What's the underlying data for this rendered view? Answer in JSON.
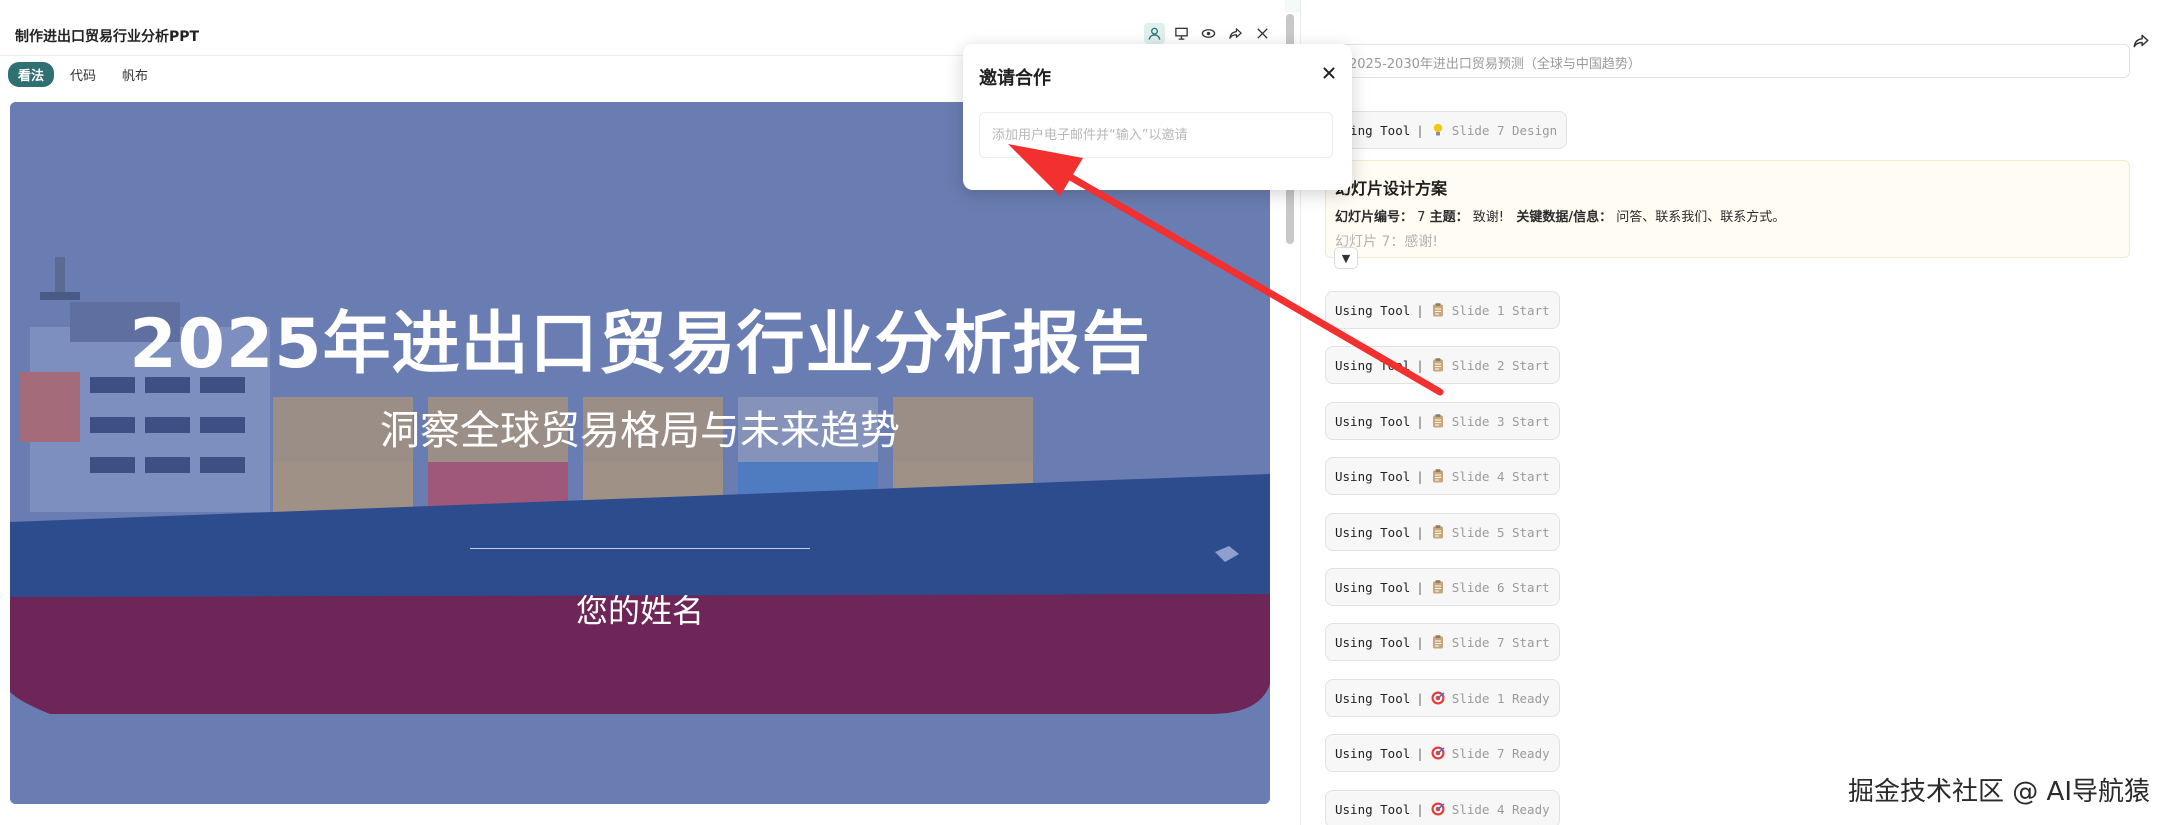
{
  "document": {
    "title": "制作进出口贸易行业分析PPT"
  },
  "header_icons": [
    {
      "name": "collaborator-icon"
    },
    {
      "name": "present-icon"
    },
    {
      "name": "preview-icon"
    },
    {
      "name": "share-icon"
    },
    {
      "name": "close-icon"
    }
  ],
  "tabs": [
    {
      "label": "看法",
      "active": true
    },
    {
      "label": "代码",
      "active": false
    },
    {
      "label": "帆布",
      "active": false
    }
  ],
  "slide": {
    "title": "2025年进出口贸易行业分析报告",
    "subtitle": "洞察全球贸易格局与未来趋势",
    "author": "您的姓名"
  },
  "invite": {
    "title": "邀请合作",
    "placeholder": "添加用户电子邮件并“输入”以邀请"
  },
  "right": {
    "prompt_text": "2025-2030年进出口贸易预测（全球与中国趋势）",
    "design_chip": {
      "using": "Using Tool",
      "sep": "|",
      "label": "Slide 7 Design",
      "icon": "lightbulb-icon"
    },
    "design_card": {
      "title": "幻灯片设计方案",
      "k1": "幻灯片编号：",
      "v1": "7",
      "k2": "主题：",
      "v2": "致谢!",
      "k3": "关键数据/信息：",
      "v3": "问答、联系我们、联系方式。",
      "faded": "幻灯片 7：感谢!",
      "expand": "▼"
    },
    "tool_calls": [
      {
        "using": "Using Tool",
        "sep": "|",
        "label": "Slide 1 Start",
        "icon": "clipboard-icon"
      },
      {
        "using": "Using Tool",
        "sep": "|",
        "label": "Slide 2 Start",
        "icon": "clipboard-icon"
      },
      {
        "using": "Using Tool",
        "sep": "|",
        "label": "Slide 3 Start",
        "icon": "clipboard-icon"
      },
      {
        "using": "Using Tool",
        "sep": "|",
        "label": "Slide 4 Start",
        "icon": "clipboard-icon"
      },
      {
        "using": "Using Tool",
        "sep": "|",
        "label": "Slide 5 Start",
        "icon": "clipboard-icon"
      },
      {
        "using": "Using Tool",
        "sep": "|",
        "label": "Slide 6 Start",
        "icon": "clipboard-icon"
      },
      {
        "using": "Using Tool",
        "sep": "|",
        "label": "Slide 7 Start",
        "icon": "clipboard-icon"
      },
      {
        "using": "Using Tool",
        "sep": "|",
        "label": "Slide 1 Ready",
        "icon": "target-icon"
      },
      {
        "using": "Using Tool",
        "sep": "|",
        "label": "Slide 7 Ready",
        "icon": "target-icon"
      },
      {
        "using": "Using Tool",
        "sep": "|",
        "label": "Slide 4 Ready",
        "icon": "target-icon"
      }
    ]
  },
  "watermark": "掘金技术社区 @ AI导航猿",
  "colors": {
    "accent": "#2f7173",
    "slide_overlay": "#6b7eb1",
    "hull_blue": "#2b4b8c",
    "hull_red": "#6e2558",
    "arrow_red": "#f23030"
  }
}
